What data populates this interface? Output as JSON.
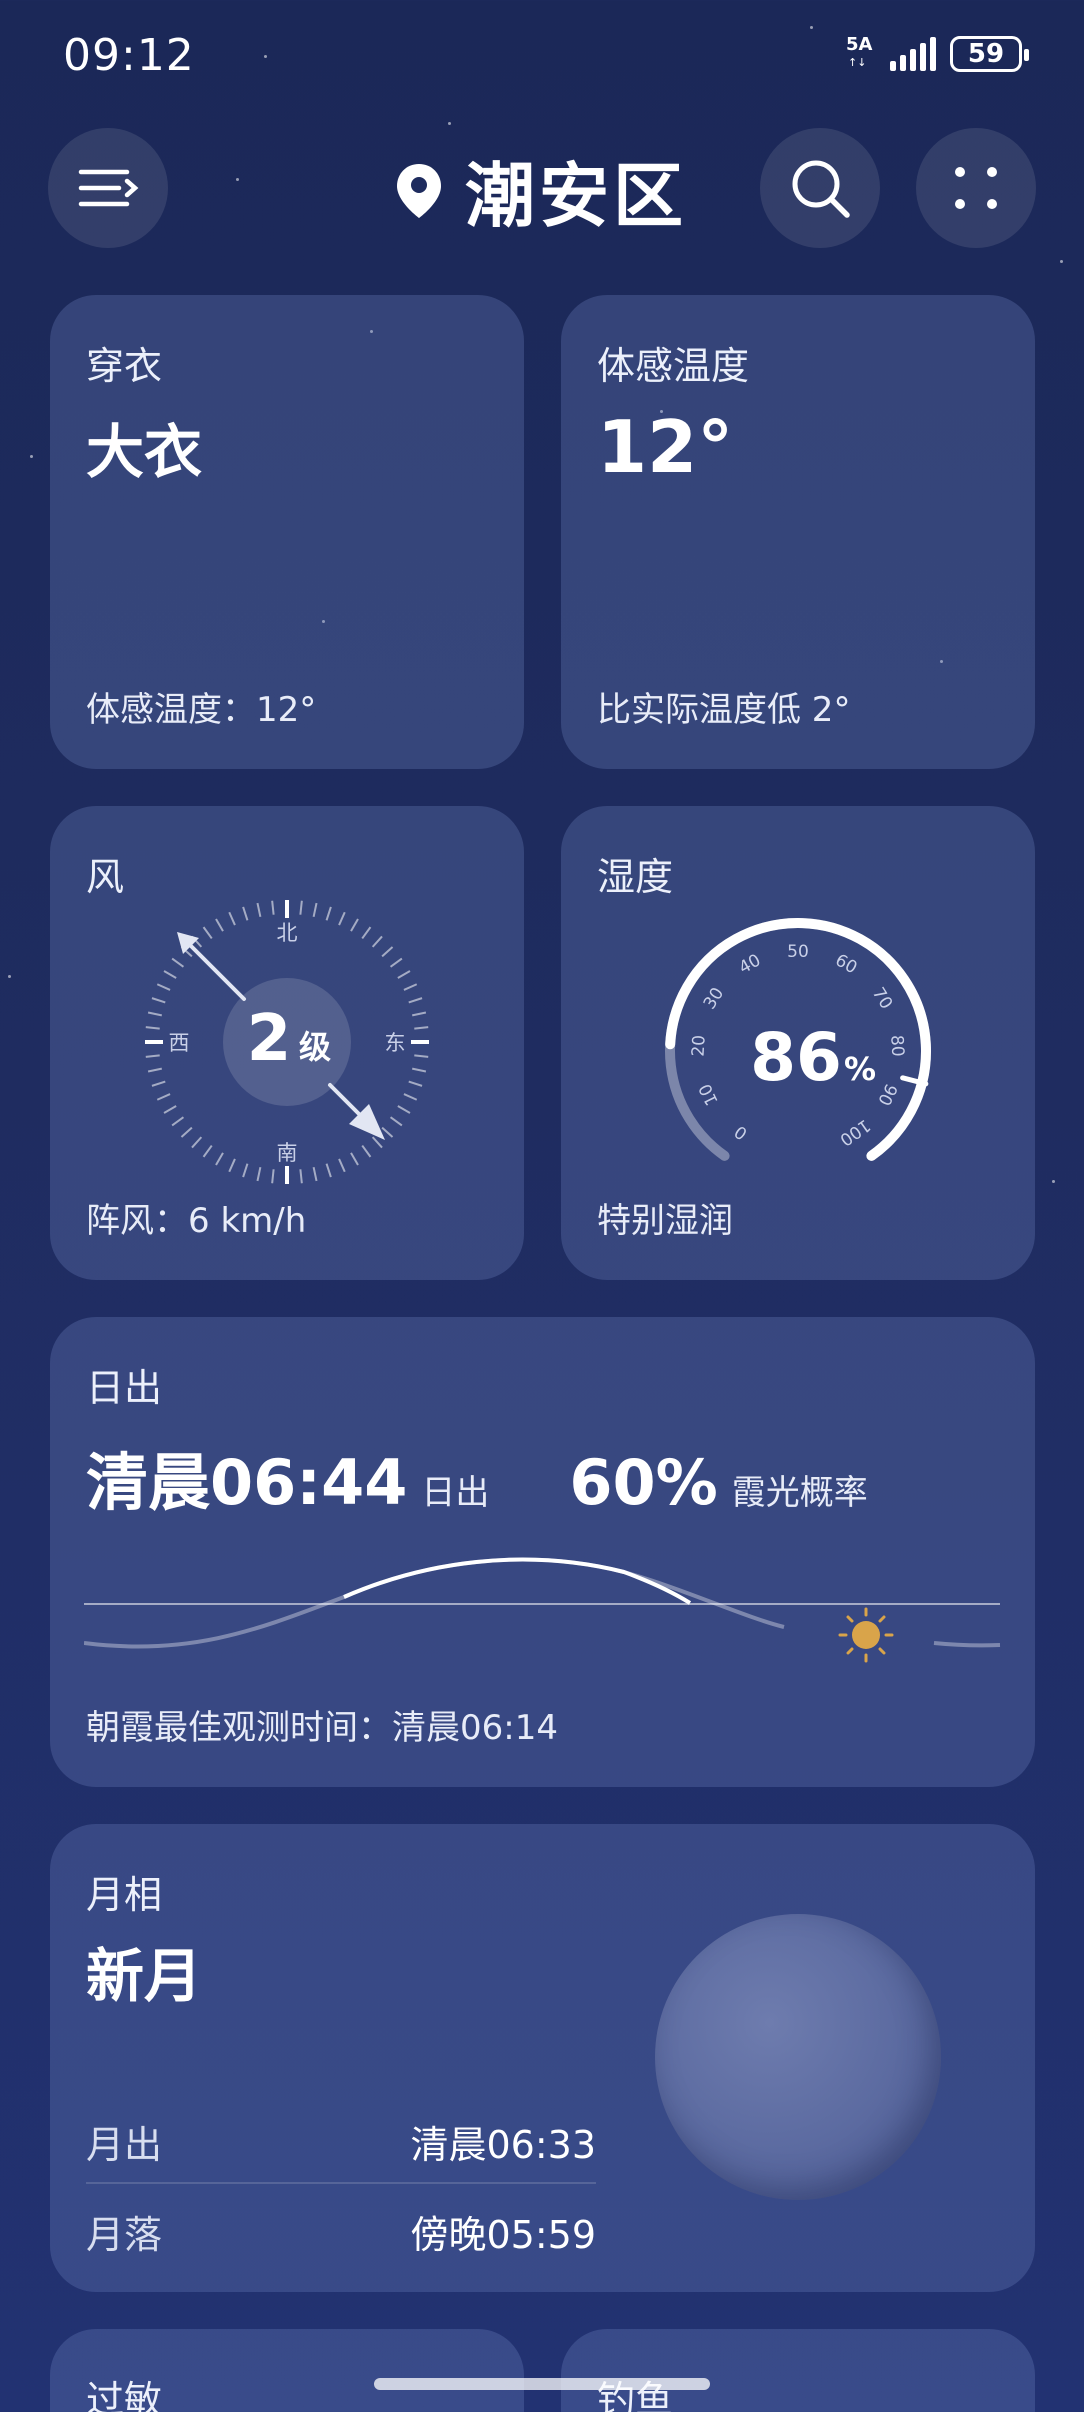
{
  "status": {
    "time": "09:12",
    "network": "5A",
    "battery": "59"
  },
  "header": {
    "location": "潮安区"
  },
  "clothing": {
    "title": "穿衣",
    "value": "大衣",
    "footer": "体感温度：12°"
  },
  "feels_like": {
    "title": "体感温度",
    "value": "12°",
    "footer": "比实际温度低 2°"
  },
  "wind": {
    "title": "风",
    "level_num": "2",
    "level_unit": "级",
    "dir_n": "北",
    "dir_s": "南",
    "dir_e": "东",
    "dir_w": "西",
    "footer": "阵风：6 km/h"
  },
  "humidity": {
    "title": "湿度",
    "value": 86,
    "value_num": "86",
    "value_unit": "%",
    "ticks": [
      "0",
      "10",
      "20",
      "30",
      "40",
      "50",
      "60",
      "70",
      "80",
      "90",
      "100"
    ],
    "footer": "特别湿润"
  },
  "sunrise": {
    "title": "日出",
    "time": "清晨06:44",
    "time_label": "日出",
    "glow_prob": "60%",
    "glow_label": "霞光概率",
    "footer": "朝霞最佳观测时间：清晨06:14"
  },
  "moon": {
    "title": "月相",
    "phase": "新月",
    "rise_label": "月出",
    "rise_time": "清晨06:33",
    "set_label": "月落",
    "set_time": "傍晚05:59"
  },
  "bottom_cards": {
    "left_title": "过敏",
    "right_title": "钓鱼"
  },
  "colors": {
    "sun": "#d9a44a",
    "card": "rgba(120,140,200,0.28)"
  }
}
